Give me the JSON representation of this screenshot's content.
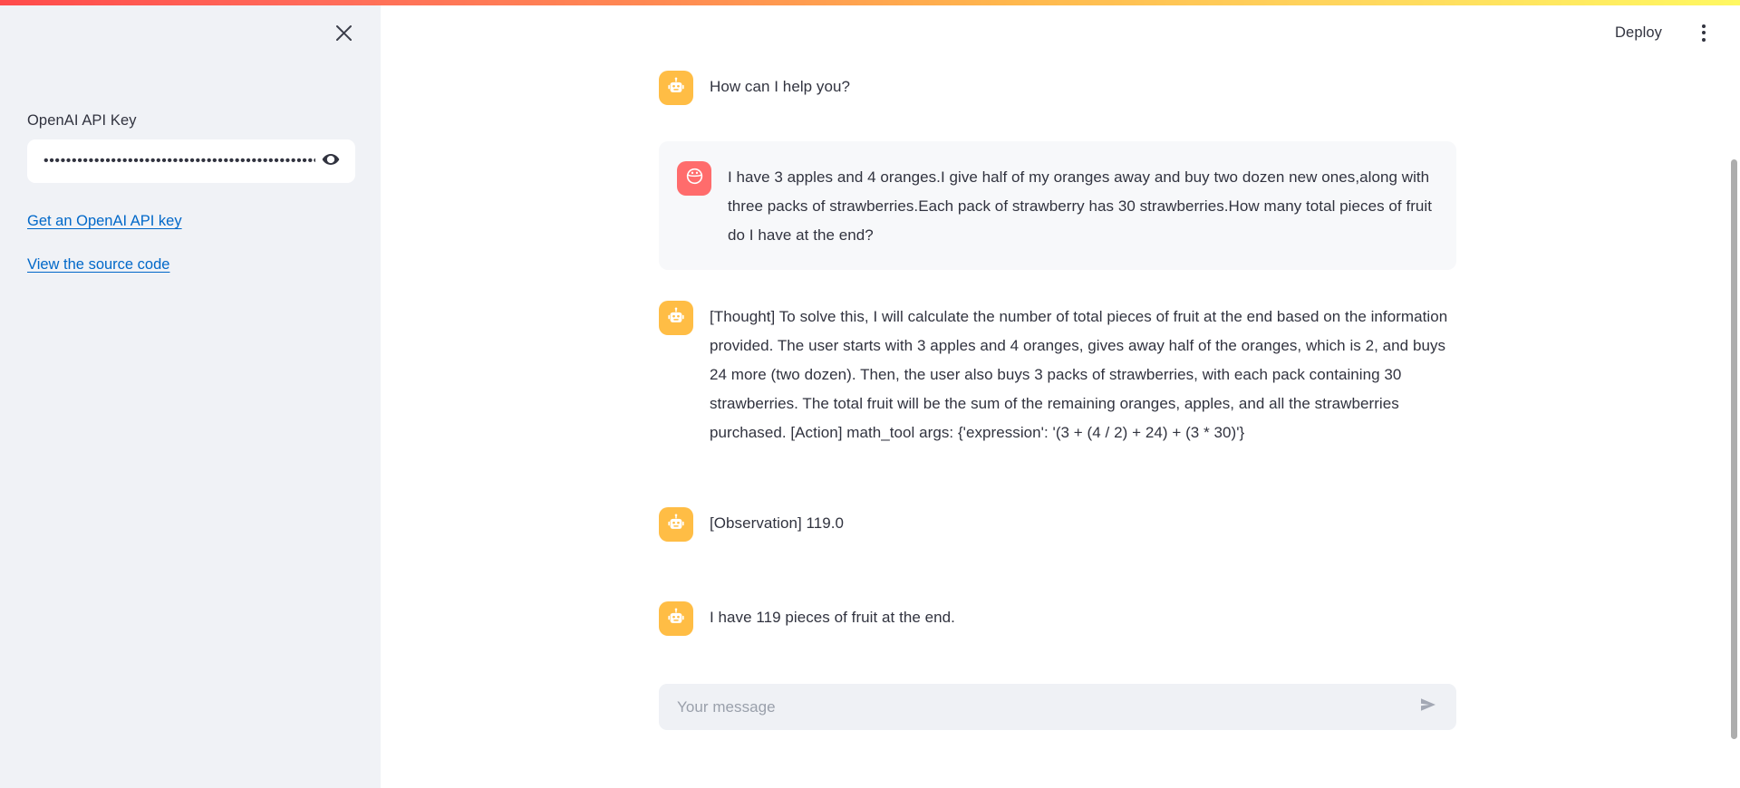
{
  "theme": {
    "gradient_start": "#ff4b4b",
    "gradient_end": "#fff861",
    "sidebar_bg": "#f0f2f6",
    "bot_avatar_color": "#ffbd45",
    "user_avatar_color": "#ff6c6c",
    "link_color": "#0068c9",
    "text_color": "#31333f",
    "user_bubble_bg": "#f7f8fa",
    "input_bg": "#eff1f5"
  },
  "sidebar": {
    "close_label": "close-icon",
    "api_key": {
      "label": "OpenAI API Key",
      "value": "••••••••••••••••••••••••••••••••••••••••••••••••••••",
      "placeholder": "",
      "toggle_icon": "eye-icon"
    },
    "links": [
      {
        "label": "Get an OpenAI API key"
      },
      {
        "label": "View the source code"
      }
    ]
  },
  "header": {
    "deploy_label": "Deploy",
    "menu_icon": "kebab-menu-icon"
  },
  "chat": {
    "messages": [
      {
        "role": "assistant",
        "avatar": "robot-icon",
        "text": "How can I help you?"
      },
      {
        "role": "user",
        "avatar": "user-face-icon",
        "text": "I have 3 apples and 4 oranges.I give half of my oranges away and buy two dozen new ones,along with three packs of strawberries.Each pack of strawberry has 30 strawberries.How many total pieces of fruit do I have at the end?"
      },
      {
        "role": "assistant",
        "avatar": "robot-icon",
        "text": "[Thought] To solve this, I will calculate the number of total pieces of fruit at the end based on the information provided. The user starts with 3 apples and 4 oranges, gives away half of the oranges, which is 2, and buys 24 more (two dozen). Then, the user also buys 3 packs of strawberries, with each pack containing 30 strawberries. The total fruit will be the sum of the remaining oranges, apples, and all the strawberries purchased. [Action] math_tool args: {'expression': '(3 + (4 / 2) + 24) + (3 * 30)'}"
      },
      {
        "role": "assistant",
        "avatar": "robot-icon",
        "text": "[Observation] 119.0"
      },
      {
        "role": "assistant",
        "avatar": "robot-icon",
        "text": "I have 119 pieces of fruit at the end."
      }
    ],
    "input": {
      "placeholder": "Your message",
      "value": "",
      "send_icon": "send-arrow-icon"
    }
  }
}
